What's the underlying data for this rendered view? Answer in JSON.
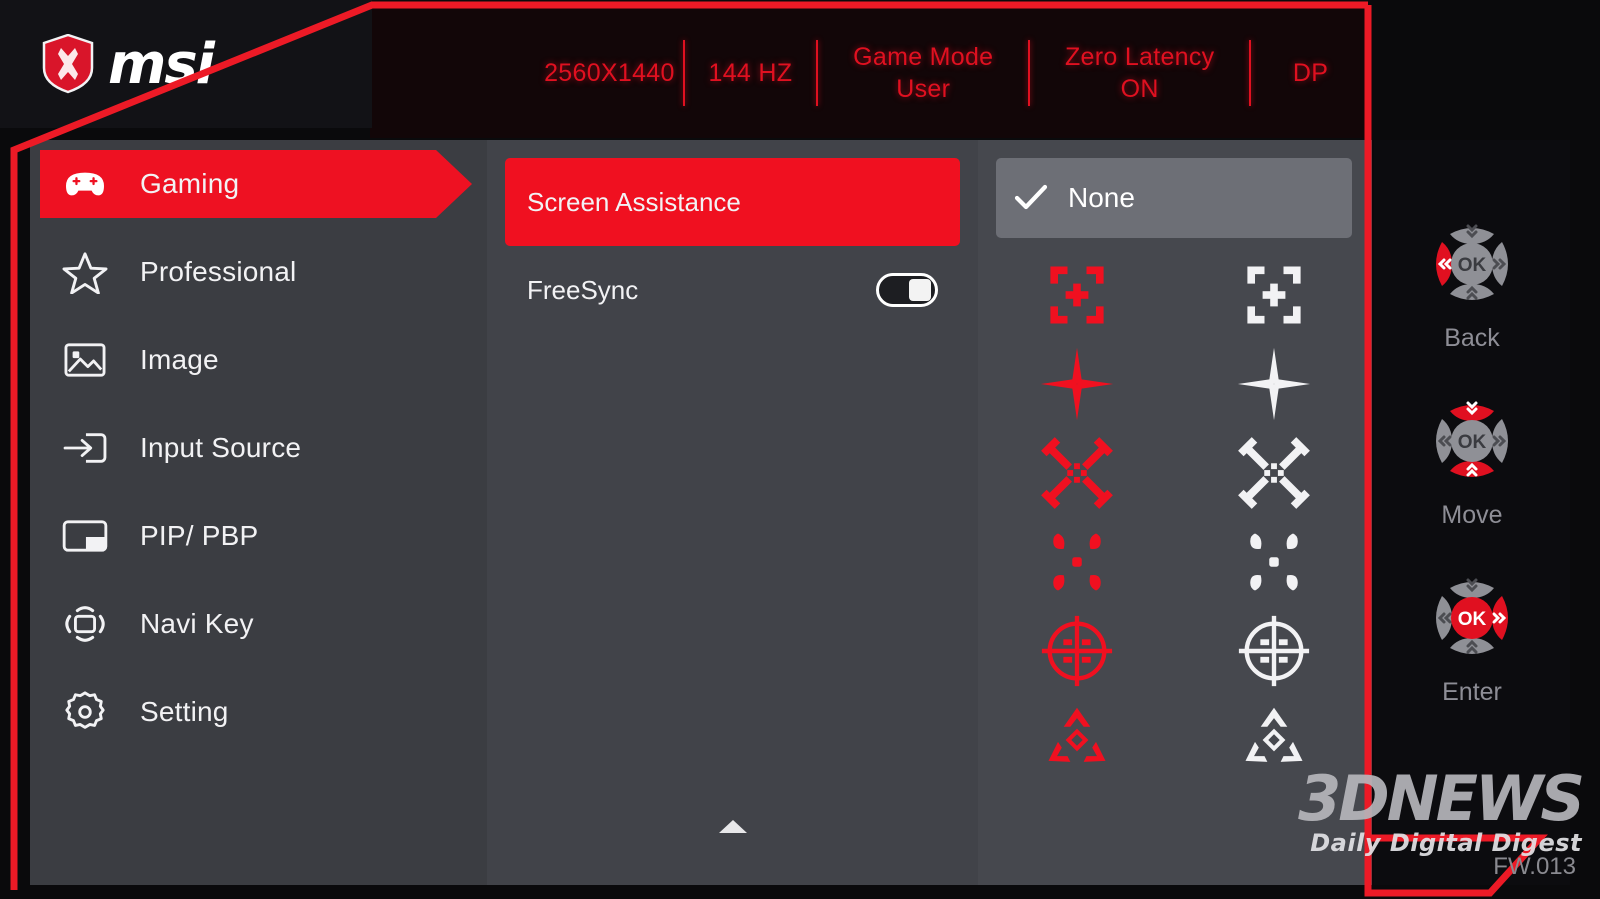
{
  "brand": {
    "logo_name": "msi-logo",
    "wordmark": "msi"
  },
  "colors": {
    "accent_red": "#e01020",
    "highlight_red": "#f01020",
    "panel_left": "#3b3d42",
    "panel_mid": "#414349",
    "panel_right": "#46484e",
    "nav_panel": "#0c0c0f",
    "selected_gray": "#6d6f76",
    "text_primary": "#f2f2f4"
  },
  "header": {
    "items": [
      {
        "line1": "2560X1440",
        "line2": ""
      },
      {
        "line1": "144 HZ",
        "line2": ""
      },
      {
        "line1": "Game Mode",
        "line2": "User"
      },
      {
        "line1": "Zero Latency",
        "line2": "ON"
      },
      {
        "line1": "DP",
        "line2": ""
      }
    ]
  },
  "sidebar": {
    "items": [
      {
        "label": "Gaming",
        "icon": "gamepad-icon",
        "active": true
      },
      {
        "label": "Professional",
        "icon": "star-icon",
        "active": false
      },
      {
        "label": "Image",
        "icon": "picture-icon",
        "active": false
      },
      {
        "label": "Input Source",
        "icon": "input-arrow-icon",
        "active": false
      },
      {
        "label": "PIP/ PBP",
        "icon": "pip-pbp-icon",
        "active": false
      },
      {
        "label": "Navi Key",
        "icon": "navi-key-icon",
        "active": false
      },
      {
        "label": "Setting",
        "icon": "gear-icon",
        "active": false
      }
    ]
  },
  "submenu": {
    "items": [
      {
        "label": "Screen Assistance",
        "selected": true,
        "control": "none"
      },
      {
        "label": "FreeSync",
        "selected": false,
        "control": "toggle",
        "toggle_state": "ON"
      }
    ],
    "scroll_indicator": "scroll-up-triangle"
  },
  "options": {
    "selected_label": "None",
    "selected_check": "check-icon",
    "crosshairs": [
      {
        "id": "bracket-cross-red",
        "color": "#f01020",
        "shape": "bracket-cross"
      },
      {
        "id": "bracket-cross-white",
        "color": "#f2f2f4",
        "shape": "bracket-cross"
      },
      {
        "id": "star-cross-red",
        "color": "#f01020",
        "shape": "star-cross"
      },
      {
        "id": "star-cross-white",
        "color": "#f2f2f4",
        "shape": "star-cross"
      },
      {
        "id": "x-blades-red",
        "color": "#f01020",
        "shape": "x-blades"
      },
      {
        "id": "x-blades-white",
        "color": "#f2f2f4",
        "shape": "x-blades"
      },
      {
        "id": "petal-dots-red",
        "color": "#f01020",
        "shape": "petal-dots"
      },
      {
        "id": "petal-dots-white",
        "color": "#f2f2f4",
        "shape": "petal-dots"
      },
      {
        "id": "scope-circle-red",
        "color": "#f01020",
        "shape": "scope-circle"
      },
      {
        "id": "scope-circle-white",
        "color": "#f2f2f4",
        "shape": "scope-circle"
      },
      {
        "id": "tri-arrow-red",
        "color": "#f01020",
        "shape": "tri-arrow"
      },
      {
        "id": "tri-arrow-white",
        "color": "#f2f2f4",
        "shape": "tri-arrow"
      }
    ]
  },
  "nav_hints": [
    {
      "label": "Back",
      "highlight": "left",
      "ok_text": "OK"
    },
    {
      "label": "Move",
      "highlight": "updown",
      "ok_text": "OK"
    },
    {
      "label": "Enter",
      "highlight": "okright",
      "ok_text": "OK"
    }
  ],
  "watermark": {
    "main": "3DNEWS",
    "sub": "Daily Digital Digest"
  },
  "firmware": {
    "text": "FW.013"
  }
}
